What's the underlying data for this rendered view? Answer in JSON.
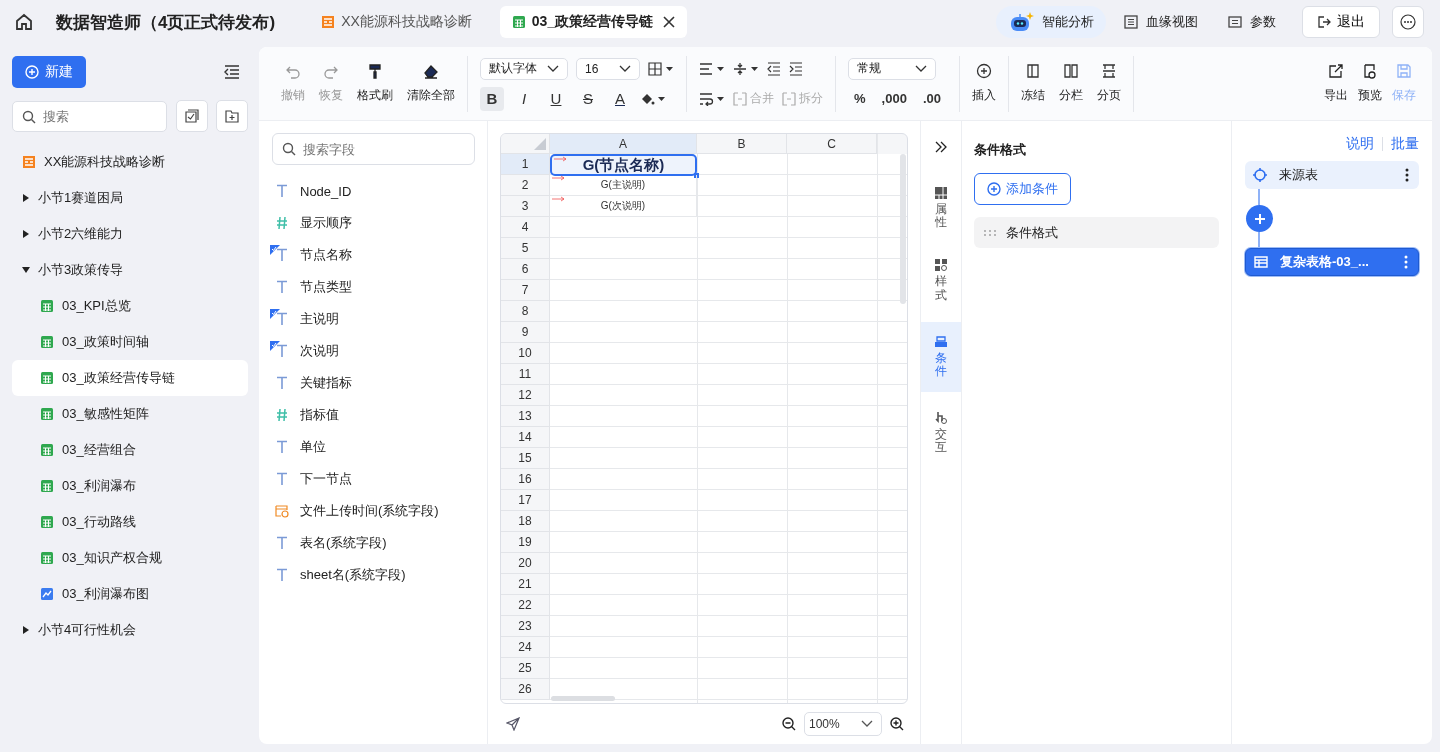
{
  "header": {
    "title": "数据智造师（4页正式待发布)",
    "tabs": [
      {
        "label": "XX能源科技战略诊断",
        "kind": "report",
        "selected": false
      },
      {
        "label": "03_政策经营传导链",
        "kind": "sheet",
        "selected": true
      }
    ],
    "actions": [
      {
        "label": "智能分析",
        "kind": "ai"
      },
      {
        "label": "血缘视图",
        "kind": "lineage"
      },
      {
        "label": "参数",
        "kind": "params"
      }
    ],
    "exit": "退出"
  },
  "sidebar": {
    "new_button": "新建",
    "search": {
      "placeholder": "搜索"
    },
    "tree": [
      {
        "label": "XX能源科技战略诊断",
        "kind": "report",
        "selected": false
      },
      {
        "label": "小节1赛道困局",
        "kind": "section",
        "expanded": false,
        "selected": false
      },
      {
        "label": "小节2六维能力",
        "kind": "section",
        "expanded": false,
        "selected": false
      },
      {
        "label": "小节3政策传导",
        "kind": "section",
        "expanded": true,
        "selected": false,
        "children": [
          {
            "label": "03_KPI总览",
            "kind": "sheet",
            "selected": false
          },
          {
            "label": "03_政策时间轴",
            "kind": "sheet",
            "selected": false
          },
          {
            "label": "03_政策经营传导链",
            "kind": "sheet",
            "selected": true
          },
          {
            "label": "03_敏感性矩阵",
            "kind": "sheet",
            "selected": false
          },
          {
            "label": "03_经营组合",
            "kind": "sheet",
            "selected": false
          },
          {
            "label": "03_利润瀑布",
            "kind": "sheet",
            "selected": false
          },
          {
            "label": "03_行动路线",
            "kind": "sheet",
            "selected": false
          },
          {
            "label": "03_知识产权合规",
            "kind": "sheet",
            "selected": false
          },
          {
            "label": "03_利润瀑布图",
            "kind": "chart",
            "selected": false
          }
        ]
      },
      {
        "label": "小节4可行性机会",
        "kind": "section",
        "expanded": false,
        "selected": false
      }
    ]
  },
  "toolbar": {
    "history": [
      {
        "kind": "undo",
        "label": "撤销",
        "disabled": true
      },
      {
        "kind": "redo",
        "label": "恢复",
        "disabled": true
      },
      {
        "kind": "painter",
        "label": "格式刷",
        "disabled": false
      },
      {
        "kind": "eraser",
        "label": "清除全部",
        "disabled": false
      }
    ],
    "font": "默认字体",
    "size": "16",
    "text_buttons": [
      {
        "label": "B",
        "kind": "bold",
        "selected": true
      },
      {
        "label": "I",
        "kind": "italic",
        "selected": false
      },
      {
        "label": "U",
        "kind": "underline",
        "selected": false
      },
      {
        "label": "S",
        "kind": "strike",
        "selected": false
      },
      {
        "label": "A",
        "kind": "color",
        "selected": false
      }
    ],
    "cell_buttons": [
      {
        "label": "合并",
        "disabled": true
      },
      {
        "label": "拆分",
        "disabled": true
      }
    ],
    "number_format": "常规",
    "number_buttons": [
      "%",
      ",000",
      ".00"
    ],
    "insert": "插入",
    "layout": [
      {
        "kind": "freeze",
        "label": "冻结"
      },
      {
        "kind": "columns",
        "label": "分栏"
      },
      {
        "kind": "page",
        "label": "分页"
      }
    ],
    "output": [
      {
        "kind": "export",
        "label": "导出",
        "disabled": false
      },
      {
        "kind": "preview",
        "label": "预览",
        "disabled": false
      },
      {
        "kind": "save",
        "label": "保存",
        "disabled": true
      }
    ]
  },
  "fields": {
    "search": {
      "placeholder": "搜索字段"
    },
    "items": [
      {
        "name": "Node_ID",
        "kind": "text",
        "checked": false
      },
      {
        "name": "显示顺序",
        "kind": "number",
        "checked": false
      },
      {
        "name": "节点名称",
        "kind": "text",
        "checked": true
      },
      {
        "name": "节点类型",
        "kind": "text",
        "checked": false
      },
      {
        "name": "主说明",
        "kind": "text",
        "checked": true
      },
      {
        "name": "次说明",
        "kind": "text",
        "checked": true
      },
      {
        "name": "关键指标",
        "kind": "text",
        "checked": false
      },
      {
        "name": "指标值",
        "kind": "number",
        "checked": false
      },
      {
        "name": "单位",
        "kind": "text",
        "checked": false
      },
      {
        "name": "下一节点",
        "kind": "text",
        "checked": false
      },
      {
        "name": "文件上传时间(系统字段)",
        "kind": "datetime",
        "checked": false
      },
      {
        "name": "表名(系统字段)",
        "kind": "text",
        "checked": false
      },
      {
        "name": "sheet名(系统字段)",
        "kind": "text",
        "checked": false
      }
    ]
  },
  "sheet": {
    "columns": [
      {
        "label": "A",
        "selected": true
      },
      {
        "label": "B",
        "selected": false
      },
      {
        "label": "C",
        "selected": false
      }
    ],
    "rows": [
      {
        "label": "1",
        "cell": "G(节点名称)",
        "selected": true
      },
      {
        "label": "2",
        "cell": "G(主说明)",
        "selected": false
      },
      {
        "label": "3",
        "cell": "G(次说明)",
        "selected": false
      },
      {
        "label": "4",
        "selected": false
      },
      {
        "label": "5",
        "selected": false
      },
      {
        "label": "6",
        "selected": false
      },
      {
        "label": "7",
        "selected": false
      },
      {
        "label": "8",
        "selected": false
      },
      {
        "label": "9",
        "selected": false
      },
      {
        "label": "10",
        "selected": false
      },
      {
        "label": "11",
        "selected": false
      },
      {
        "label": "12",
        "selected": false
      },
      {
        "label": "13",
        "selected": false
      },
      {
        "label": "14",
        "selected": false
      },
      {
        "label": "15",
        "selected": false
      },
      {
        "label": "16",
        "selected": false
      },
      {
        "label": "17",
        "selected": false
      },
      {
        "label": "18",
        "selected": false
      },
      {
        "label": "19",
        "selected": false
      },
      {
        "label": "20",
        "selected": false
      },
      {
        "label": "21",
        "selected": false
      },
      {
        "label": "22",
        "selected": false
      },
      {
        "label": "23",
        "selected": false
      },
      {
        "label": "24",
        "selected": false
      },
      {
        "label": "25",
        "selected": false
      },
      {
        "label": "26",
        "selected": false
      }
    ],
    "zoom": "100%"
  },
  "side_tabs": [
    {
      "label": "属性",
      "kind": "props",
      "selected": false
    },
    {
      "label": "样式",
      "kind": "style",
      "selected": false
    },
    {
      "label": "条件",
      "kind": "cond",
      "selected": true
    },
    {
      "label": "交互",
      "kind": "interact",
      "selected": false
    }
  ],
  "conditions": {
    "title": "条件格式",
    "add_button": "添加条件",
    "items": [
      "条件格式"
    ]
  },
  "flow": {
    "links": [
      "说明",
      "批量"
    ],
    "nodes": [
      {
        "label": "来源表",
        "kind": "source",
        "selected": false
      },
      {
        "label": "复杂表格-03_...",
        "kind": "table",
        "selected": true
      }
    ]
  }
}
